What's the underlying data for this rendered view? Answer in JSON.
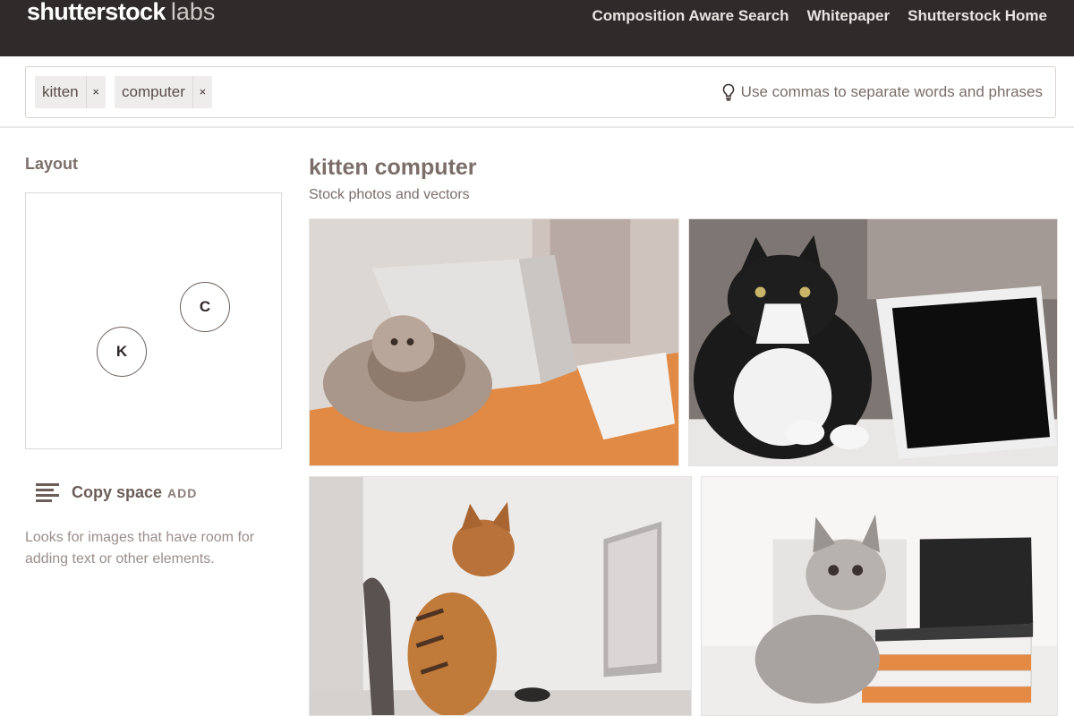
{
  "brand": {
    "main": "shutterstock",
    "sub": "labs"
  },
  "nav": {
    "items": [
      "Composition Aware Search",
      "Whitepaper",
      "Shutterstock Home"
    ]
  },
  "search": {
    "chips": [
      {
        "label": "kitten",
        "remove": "×"
      },
      {
        "label": "computer",
        "remove": "×"
      }
    ],
    "hint": "Use commas to separate words and phrases",
    "hint_icon": "lightbulb-icon"
  },
  "sidebar": {
    "layout_title": "Layout",
    "tokens": [
      "C",
      "K"
    ],
    "copy_space": {
      "label": "Copy space",
      "action": "ADD",
      "icon": "text-lines-icon"
    },
    "copy_space_desc": "Looks for images that have room for adding text or other elements."
  },
  "results": {
    "title": "kitten computer",
    "subtitle": "Stock photos and vectors"
  },
  "colors": {
    "topbar": "#2f2b2b",
    "accent_orange": "#e08a45"
  }
}
